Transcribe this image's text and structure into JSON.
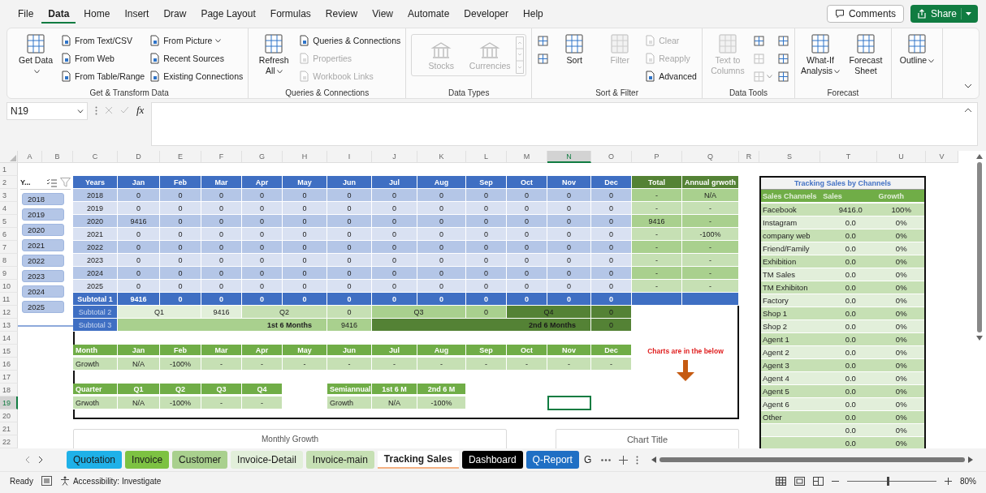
{
  "menu_tabs": [
    {
      "label": "File",
      "selected": false
    },
    {
      "label": "Data",
      "selected": true
    },
    {
      "label": "Home",
      "selected": false
    },
    {
      "label": "Insert",
      "selected": false
    },
    {
      "label": "Draw",
      "selected": false
    },
    {
      "label": "Page Layout",
      "selected": false
    },
    {
      "label": "Formulas",
      "selected": false
    },
    {
      "label": "Review",
      "selected": false
    },
    {
      "label": "View",
      "selected": false
    },
    {
      "label": "Automate",
      "selected": false
    },
    {
      "label": "Developer",
      "selected": false
    },
    {
      "label": "Help",
      "selected": false
    }
  ],
  "comments_button": "Comments",
  "share_button": "Share",
  "ribbon": [
    {
      "title": "Get & Transform Data",
      "items": [
        {
          "kind": "large",
          "label": "Get Data",
          "dropdown": true,
          "disabled": false
        },
        {
          "kind": "small",
          "label": "From Text/CSV",
          "dropdown": false,
          "disabled": false
        },
        {
          "kind": "small",
          "label": "From Web",
          "dropdown": false,
          "disabled": false
        },
        {
          "kind": "small",
          "label": "From Table/Range",
          "dropdown": false,
          "disabled": false
        },
        {
          "kind": "small",
          "label": "From Picture",
          "dropdown": true,
          "disabled": false
        },
        {
          "kind": "small",
          "label": "Recent Sources",
          "dropdown": false,
          "disabled": false
        },
        {
          "kind": "small",
          "label": "Existing Connections",
          "dropdown": false,
          "disabled": false
        }
      ]
    },
    {
      "title": "Queries & Connections",
      "items": [
        {
          "kind": "large",
          "label": "Refresh All",
          "dropdown": true,
          "disabled": false
        },
        {
          "kind": "small",
          "label": "Queries & Connections",
          "dropdown": false,
          "disabled": false
        },
        {
          "kind": "small",
          "label": "Properties",
          "dropdown": false,
          "disabled": true
        },
        {
          "kind": "small",
          "label": "Workbook Links",
          "dropdown": false,
          "disabled": true
        }
      ]
    },
    {
      "title": "Data Types",
      "items": [
        {
          "kind": "gallery",
          "label": "Stocks",
          "dropdown": false,
          "disabled": true
        },
        {
          "kind": "gallery",
          "label": "Currencies",
          "dropdown": false,
          "disabled": true
        }
      ]
    },
    {
      "title": "Sort & Filter",
      "items": [
        {
          "kind": "icon",
          "dropdown": false,
          "disabled": false
        },
        {
          "kind": "icon",
          "dropdown": false,
          "disabled": false
        },
        {
          "kind": "large",
          "label": "Sort",
          "dropdown": false,
          "disabled": false
        },
        {
          "kind": "large",
          "label": "Filter",
          "dropdown": false,
          "disabled": true
        },
        {
          "kind": "small",
          "label": "Clear",
          "dropdown": false,
          "disabled": true
        },
        {
          "kind": "small",
          "label": "Reapply",
          "dropdown": false,
          "disabled": true
        },
        {
          "kind": "small",
          "label": "Advanced",
          "dropdown": false,
          "disabled": false
        }
      ]
    },
    {
      "title": "Data Tools",
      "items": [
        {
          "kind": "large",
          "label": "Text to Columns",
          "dropdown": false,
          "disabled": true
        },
        {
          "kind": "icon",
          "dropdown": false,
          "disabled": false
        },
        {
          "kind": "icon",
          "dropdown": false,
          "disabled": true
        },
        {
          "kind": "icon",
          "dropdown": true,
          "disabled": true
        },
        {
          "kind": "icon",
          "dropdown": false,
          "disabled": false
        },
        {
          "kind": "icon",
          "dropdown": false,
          "disabled": false
        },
        {
          "kind": "icon",
          "dropdown": false,
          "disabled": false
        }
      ]
    },
    {
      "title": "Forecast",
      "items": [
        {
          "kind": "large",
          "label": "What-If Analysis",
          "dropdown": true,
          "disabled": false
        },
        {
          "kind": "large",
          "label": "Forecast Sheet",
          "dropdown": false,
          "disabled": false
        }
      ]
    },
    {
      "items": [
        {
          "kind": "large",
          "label": "Outline",
          "dropdown": true,
          "disabled": false
        }
      ]
    }
  ],
  "formula_bar": {
    "name_box": "N19",
    "function_label": "fx"
  },
  "column_headers": [
    {
      "label": "A",
      "selected": false
    },
    {
      "label": "B",
      "selected": false
    },
    {
      "label": "C",
      "selected": false
    },
    {
      "label": "D",
      "selected": false
    },
    {
      "label": "E",
      "selected": false
    },
    {
      "label": "F",
      "selected": false
    },
    {
      "label": "G",
      "selected": false
    },
    {
      "label": "H",
      "selected": false
    },
    {
      "label": "I",
      "selected": false
    },
    {
      "label": "J",
      "selected": false
    },
    {
      "label": "K",
      "selected": false
    },
    {
      "label": "L",
      "selected": false
    },
    {
      "label": "M",
      "selected": false
    },
    {
      "label": "N",
      "selected": true
    },
    {
      "label": "O",
      "selected": false
    },
    {
      "label": "P",
      "selected": false
    },
    {
      "label": "Q",
      "selected": false
    },
    {
      "label": "R",
      "selected": false
    },
    {
      "label": "S",
      "selected": false
    },
    {
      "label": "T",
      "selected": false
    },
    {
      "label": "U",
      "selected": false
    },
    {
      "label": "V",
      "selected": false
    }
  ],
  "row_headers": [
    {
      "label": "1",
      "selected": false
    },
    {
      "label": "2",
      "selected": false
    },
    {
      "label": "3",
      "selected": false
    },
    {
      "label": "4",
      "selected": false
    },
    {
      "label": "5",
      "selected": false
    },
    {
      "label": "6",
      "selected": false
    },
    {
      "label": "7",
      "selected": false
    },
    {
      "label": "8",
      "selected": false
    },
    {
      "label": "9",
      "selected": false
    },
    {
      "label": "10",
      "selected": false
    },
    {
      "label": "11",
      "selected": false
    },
    {
      "label": "12",
      "selected": false
    },
    {
      "label": "13",
      "selected": false
    },
    {
      "label": "14",
      "selected": false
    },
    {
      "label": "15",
      "selected": false
    },
    {
      "label": "16",
      "selected": false
    },
    {
      "label": "17",
      "selected": false
    },
    {
      "label": "18",
      "selected": false
    },
    {
      "label": "19",
      "selected": true
    },
    {
      "label": "20",
      "selected": false
    },
    {
      "label": "21",
      "selected": false
    },
    {
      "label": "22",
      "selected": false
    }
  ],
  "slicer": {
    "title": "Y...",
    "items": [
      {
        "label": "2018",
        "selected": true
      },
      {
        "label": "2019",
        "selected": true
      },
      {
        "label": "2020",
        "selected": true
      },
      {
        "label": "2021",
        "selected": true
      },
      {
        "label": "2022",
        "selected": true
      },
      {
        "label": "2023",
        "selected": true
      },
      {
        "label": "2024",
        "selected": true
      },
      {
        "label": "2025",
        "selected": true
      }
    ]
  },
  "main_table": {
    "headers": [
      "Years",
      "Jan",
      "Feb",
      "Mar",
      "Apr",
      "May",
      "Jun",
      "Jul",
      "Aug",
      "Sep",
      "Oct",
      "Nov",
      "Dec",
      "Total",
      "Annual grwoth"
    ],
    "rows": [
      {
        "year": "2018",
        "values": [
          "0",
          "0",
          "0",
          "0",
          "0",
          "0",
          "0",
          "0",
          "0",
          "0",
          "0",
          "0"
        ],
        "total": "-",
        "growth": "N/A"
      },
      {
        "year": "2019",
        "values": [
          "0",
          "0",
          "0",
          "0",
          "0",
          "0",
          "0",
          "0",
          "0",
          "0",
          "0",
          "0"
        ],
        "total": "-",
        "growth": "-"
      },
      {
        "year": "2020",
        "values": [
          "9416",
          "0",
          "0",
          "0",
          "0",
          "0",
          "0",
          "0",
          "0",
          "0",
          "0",
          "0"
        ],
        "total": "9416",
        "growth": "-"
      },
      {
        "year": "2021",
        "values": [
          "0",
          "0",
          "0",
          "0",
          "0",
          "0",
          "0",
          "0",
          "0",
          "0",
          "0",
          "0"
        ],
        "total": "-",
        "growth": "-100%"
      },
      {
        "year": "2022",
        "values": [
          "0",
          "0",
          "0",
          "0",
          "0",
          "0",
          "0",
          "0",
          "0",
          "0",
          "0",
          "0"
        ],
        "total": "-",
        "growth": "-"
      },
      {
        "year": "2023",
        "values": [
          "0",
          "0",
          "0",
          "0",
          "0",
          "0",
          "0",
          "0",
          "0",
          "0",
          "0",
          "0"
        ],
        "total": "-",
        "growth": "-"
      },
      {
        "year": "2024",
        "values": [
          "0",
          "0",
          "0",
          "0",
          "0",
          "0",
          "0",
          "0",
          "0",
          "0",
          "0",
          "0"
        ],
        "total": "-",
        "growth": "-"
      },
      {
        "year": "2025",
        "values": [
          "0",
          "0",
          "0",
          "0",
          "0",
          "0",
          "0",
          "0",
          "0",
          "0",
          "0",
          "0"
        ],
        "total": "-",
        "growth": "-"
      }
    ],
    "subtotal_1": {
      "label": "Subtotal 1",
      "values": [
        "9416",
        "0",
        "0",
        "0",
        "0",
        "0",
        "0",
        "0",
        "0",
        "0",
        "0",
        "0"
      ]
    },
    "subtotal_2": {
      "label": "Subtotal 2",
      "cells": [
        {
          "text": "Q1",
          "color": "#e2efda"
        },
        {
          "text": "9416",
          "color": "#e2efda"
        },
        {
          "text": "Q2",
          "color": "#c6e0b4"
        },
        {
          "text": "0",
          "color": "#c6e0b4"
        },
        {
          "text": "Q3",
          "color": "#a9d08e"
        },
        {
          "text": "0",
          "color": "#a9d08e"
        },
        {
          "text": "Q4",
          "color": "#548235"
        },
        {
          "text": "0",
          "color": "#548235"
        }
      ]
    },
    "subtotal_3": {
      "label": "Subtotal 3",
      "cells": [
        {
          "text": "1st 6 Months",
          "color": "#a9d08e"
        },
        {
          "text": "9416",
          "color": "#a9d08e"
        },
        {
          "text": "2nd 6 Months",
          "color": "#548235"
        },
        {
          "text": "0",
          "color": "#548235"
        }
      ]
    }
  },
  "monthly_growth": {
    "headers": [
      "Month",
      "Jan",
      "Feb",
      "Mar",
      "Apr",
      "May",
      "Jun",
      "Jul",
      "Aug",
      "Sep",
      "Oct",
      "Nov",
      "Dec"
    ],
    "row": [
      "Growth",
      "N/A",
      "-100%",
      "-",
      "-",
      "-",
      "-",
      "-",
      "-",
      "-",
      "-",
      "-",
      "-"
    ]
  },
  "quarterly_growth": {
    "headers": [
      "Quarter",
      "Q1",
      "Q2",
      "Q3",
      "Q4"
    ],
    "row": [
      "Grwoth",
      "N/A",
      "-100%",
      "-",
      "-"
    ]
  },
  "semiannual_growth": {
    "headers": [
      "Semiannual",
      "1st 6 M",
      "2nd 6 M"
    ],
    "row": [
      "Growth",
      "N/A",
      "-100%"
    ]
  },
  "chart_note": "Charts are in the below",
  "chart_cards": [
    {
      "title": "Monthly Growth"
    },
    {
      "title": "Chart Title"
    }
  ],
  "tracking": {
    "title": "Tracking Sales by Channels",
    "columns": [
      "Sales Channels",
      "Sales",
      "Growth"
    ],
    "rows": [
      {
        "channel": "Facebook",
        "sales": "9416.0",
        "growth": "100%"
      },
      {
        "channel": "Instagram",
        "sales": "0.0",
        "growth": "0%"
      },
      {
        "channel": "company web",
        "sales": "0.0",
        "growth": "0%"
      },
      {
        "channel": "Friend/Family",
        "sales": "0.0",
        "growth": "0%"
      },
      {
        "channel": "Exhibition",
        "sales": "0.0",
        "growth": "0%"
      },
      {
        "channel": "TM Sales",
        "sales": "0.0",
        "growth": "0%"
      },
      {
        "channel": "TM Exhibiton",
        "sales": "0.0",
        "growth": "0%"
      },
      {
        "channel": "Factory",
        "sales": "0.0",
        "growth": "0%"
      },
      {
        "channel": "Shop 1",
        "sales": "0.0",
        "growth": "0%"
      },
      {
        "channel": "Shop 2",
        "sales": "0.0",
        "growth": "0%"
      },
      {
        "channel": "Agent 1",
        "sales": "0.0",
        "growth": "0%"
      },
      {
        "channel": "Agent 2",
        "sales": "0.0",
        "growth": "0%"
      },
      {
        "channel": "Agent 3",
        "sales": "0.0",
        "growth": "0%"
      },
      {
        "channel": "Agent 4",
        "sales": "0.0",
        "growth": "0%"
      },
      {
        "channel": "Agent 5",
        "sales": "0.0",
        "growth": "0%"
      },
      {
        "channel": "Agent 6",
        "sales": "0.0",
        "growth": "0%"
      },
      {
        "channel": "Other",
        "sales": "0.0",
        "growth": "0%"
      },
      {
        "sales": "0.0",
        "growth": "0%"
      },
      {
        "sales": "0.0",
        "growth": "0%"
      }
    ]
  },
  "sheet_tabs": [
    {
      "label": "Quotation",
      "color": "#1fb1e8",
      "selected": false
    },
    {
      "label": "Invoice",
      "color": "#7dc242",
      "selected": false
    },
    {
      "label": "Customer",
      "color": "#a9d08e",
      "selected": false
    },
    {
      "label": "Invoice-Detail",
      "color": "#e2efda",
      "selected": false
    },
    {
      "label": "Invoice-main",
      "color": "#c6e0b4",
      "selected": false
    },
    {
      "label": "Tracking Sales",
      "color": "#f4b183",
      "selected": true
    },
    {
      "label": "Dashboard",
      "color": "#000000",
      "selected": false
    },
    {
      "label": "Q-Report",
      "color": "#1f6fc4",
      "selected": false
    }
  ],
  "cut_tab": "G",
  "status_bar": {
    "status": "Ready",
    "accessibility": "Accessibility: Investigate",
    "zoom": "80%",
    "zoom_level": {
      "level": 0.45
    }
  }
}
